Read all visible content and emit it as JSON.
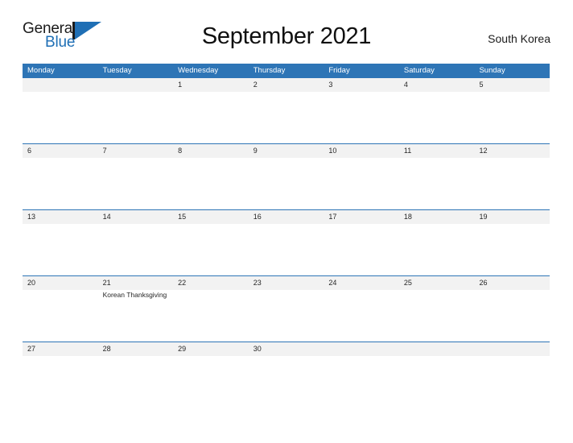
{
  "brand": {
    "name_part1": "General",
    "name_part2": "Blue",
    "flag_icon": "flag-triangle-icon",
    "colors": {
      "text_dark": "#1b1b1b",
      "accent_blue": "#1f6fb5"
    }
  },
  "header": {
    "title": "September 2021",
    "month": "September",
    "year": "2021",
    "location": "South Korea"
  },
  "theme": {
    "header_bar_blue": "#2e75b6",
    "date_band_gray": "#f2f2f2",
    "page_background": "#ffffff",
    "text_color": "#262626"
  },
  "calendar": {
    "week_start": "Monday",
    "day_headers": [
      "Monday",
      "Tuesday",
      "Wednesday",
      "Thursday",
      "Friday",
      "Saturday",
      "Sunday"
    ],
    "weeks": [
      {
        "days": [
          {
            "date": "",
            "events": []
          },
          {
            "date": "",
            "events": []
          },
          {
            "date": "1",
            "events": []
          },
          {
            "date": "2",
            "events": []
          },
          {
            "date": "3",
            "events": []
          },
          {
            "date": "4",
            "events": []
          },
          {
            "date": "5",
            "events": []
          }
        ]
      },
      {
        "days": [
          {
            "date": "6",
            "events": []
          },
          {
            "date": "7",
            "events": []
          },
          {
            "date": "8",
            "events": []
          },
          {
            "date": "9",
            "events": []
          },
          {
            "date": "10",
            "events": []
          },
          {
            "date": "11",
            "events": []
          },
          {
            "date": "12",
            "events": []
          }
        ]
      },
      {
        "days": [
          {
            "date": "13",
            "events": []
          },
          {
            "date": "14",
            "events": []
          },
          {
            "date": "15",
            "events": []
          },
          {
            "date": "16",
            "events": []
          },
          {
            "date": "17",
            "events": []
          },
          {
            "date": "18",
            "events": []
          },
          {
            "date": "19",
            "events": []
          }
        ]
      },
      {
        "days": [
          {
            "date": "20",
            "events": []
          },
          {
            "date": "21",
            "events": [
              "Korean Thanksgiving"
            ]
          },
          {
            "date": "22",
            "events": []
          },
          {
            "date": "23",
            "events": []
          },
          {
            "date": "24",
            "events": []
          },
          {
            "date": "25",
            "events": []
          },
          {
            "date": "26",
            "events": []
          }
        ]
      },
      {
        "days": [
          {
            "date": "27",
            "events": []
          },
          {
            "date": "28",
            "events": []
          },
          {
            "date": "29",
            "events": []
          },
          {
            "date": "30",
            "events": []
          },
          {
            "date": "",
            "events": []
          },
          {
            "date": "",
            "events": []
          },
          {
            "date": "",
            "events": []
          }
        ]
      }
    ]
  }
}
